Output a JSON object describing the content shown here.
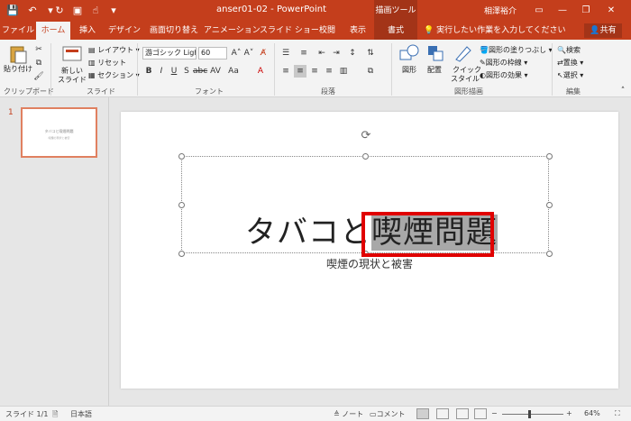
{
  "titlebar": {
    "doc_title": "anser01-02  -  PowerPoint",
    "context_tools": "描画ツール",
    "user": "相澤裕介",
    "qat": {
      "save_icon": "save-icon",
      "undo_icon": "undo-icon",
      "redo_icon": "redo-icon",
      "present_icon": "present-icon",
      "touch_icon": "touch-icon",
      "customize_icon": "customize-icon"
    },
    "window": {
      "ribbon_options": "ribbon-display-options-icon",
      "minimize": "minimize-icon",
      "restore": "restore-icon",
      "close": "close-icon"
    }
  },
  "tabs": [
    "ファイル",
    "ホーム",
    "挿入",
    "デザイン",
    "画面切り替え",
    "アニメーション",
    "スライド ショー",
    "校閲",
    "表示",
    "書式"
  ],
  "active_tab": "ホーム",
  "tell_me": "実行したい作業を入力してください",
  "share": "共有",
  "ribbon": {
    "clipboard": {
      "paste": "貼り付け",
      "label": "クリップボード"
    },
    "slides": {
      "new_slide": "新しい",
      "new_slide2": "スライド",
      "layout": "レイアウト",
      "reset": "リセット",
      "section": "セクション",
      "label": "スライド"
    },
    "font": {
      "font_name": "游ゴシック Ligh",
      "font_size": "60",
      "label": "フォント"
    },
    "paragraph": {
      "label": "段落"
    },
    "drawing": {
      "shapes": "図形",
      "arrange": "配置",
      "quick_styles": "クイック",
      "quick_styles2": "スタイル",
      "fill": "図形の塗りつぶし",
      "outline": "図形の枠線",
      "effects": "図形の効果",
      "label": "図形描画"
    },
    "editing": {
      "find": "検索",
      "replace": "置換",
      "select": "選択",
      "label": "編集"
    }
  },
  "thumbnail": {
    "number": "1",
    "title": "タバコと喫煙問題",
    "subtitle": "喫煙の現状と被害"
  },
  "slide": {
    "title_plain": "タバコと",
    "title_selected": "喫煙問題",
    "subtitle": "喫煙の現状と被害"
  },
  "status": {
    "slide_count": "スライド 1/1",
    "language": "日本語",
    "notes": "ノート",
    "comments": "コメント",
    "zoom": "64%"
  },
  "colors": {
    "accent": "#c43e1c",
    "highlight_box": "#e00000"
  }
}
